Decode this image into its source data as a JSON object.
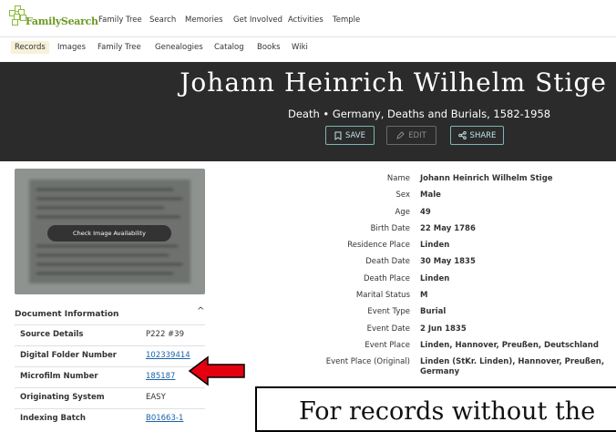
{
  "brand": {
    "name": "FamilySearch"
  },
  "topnav": [
    "Family Tree",
    "Search",
    "Memories",
    "Get Involved",
    "Activities",
    "Temple"
  ],
  "subnav": {
    "active": "Records",
    "items": [
      "Records",
      "Images",
      "Family Tree",
      "Genealogies",
      "Catalog",
      "Books",
      "Wiki"
    ]
  },
  "hero": {
    "name": "Johann Heinrich Wilhelm Stige",
    "subtitle": "Death • Germany, Deaths and Burials, 1582-1958",
    "save": "SAVE",
    "edit": "EDIT",
    "share": "SHARE"
  },
  "image_panel": {
    "button": "Check Image Availability"
  },
  "document_info": {
    "title": "Document Information",
    "rows": [
      {
        "label": "Source Details",
        "value": "P222 #39",
        "link": false
      },
      {
        "label": "Digital Folder Number",
        "value": "102339414",
        "link": true
      },
      {
        "label": "Microfilm Number",
        "value": "185187",
        "link": true
      },
      {
        "label": "Originating System",
        "value": "EASY",
        "link": false
      },
      {
        "label": "Indexing Batch",
        "value": "B01663-1",
        "link": true
      }
    ]
  },
  "details": [
    {
      "label": "Name",
      "value": "Johann Heinrich Wilhelm Stige"
    },
    {
      "label": "Sex",
      "value": "Male"
    },
    {
      "label": "Age",
      "value": "49"
    },
    {
      "label": "Birth Date",
      "value": "22 May 1786"
    },
    {
      "label": "Residence Place",
      "value": "Linden"
    },
    {
      "label": "Death Date",
      "value": "30 May 1835"
    },
    {
      "label": "Death Place",
      "value": "Linden"
    },
    {
      "label": "Marital Status",
      "value": "M"
    },
    {
      "label": "Event Type",
      "value": "Burial"
    },
    {
      "label": "Event Date",
      "value": "2 Jun 1835"
    },
    {
      "label": "Event Place",
      "value": "Linden, Hannover, Preußen, Deutschland"
    },
    {
      "label": "Event Place (Original)",
      "value": "Linden (StKr. Linden), Hannover, Preußen, Germany"
    }
  ],
  "callout": {
    "text": "For records without the"
  },
  "colors": {
    "hero_bg": "#2b2b2b",
    "link": "#1a63a8",
    "arrow": "#e3000f",
    "brand_green": "#6c9a22"
  }
}
